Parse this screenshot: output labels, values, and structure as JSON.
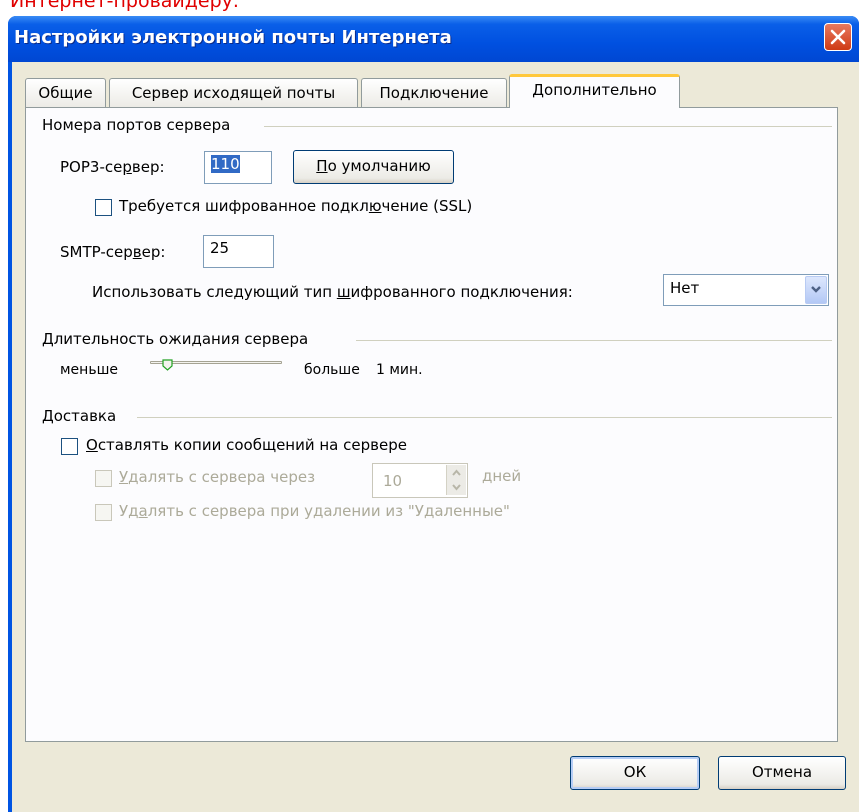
{
  "top_text": "Интернет-провайдеру.",
  "window": {
    "title": "Настройки электронной почты Интернета"
  },
  "tabs": [
    {
      "label": "Общие"
    },
    {
      "label": "Сервер исходящей почты"
    },
    {
      "label": "Подключение"
    },
    {
      "label": "Дополнительно"
    }
  ],
  "ports": {
    "group_label": "Номера портов сервера",
    "pop3_label_a": "POP3-се",
    "pop3_label_u": "р",
    "pop3_label_b": "вер:",
    "pop3_value": "110",
    "default_label": "По умолчанию",
    "default_u": "П",
    "ssl_label_a": "Требуется шифрованное подкл",
    "ssl_label_u": "ю",
    "ssl_label_b": "чение (SSL)",
    "smtp_label_a": "SMTP-сер",
    "smtp_label_u": "в",
    "smtp_label_b": "ер:",
    "smtp_value": "25",
    "encryption_label_a": "Использовать следующий тип ",
    "encryption_label_u": "ш",
    "encryption_label_b": "ифрованного подключения:",
    "encryption_value": "Нет"
  },
  "timeout": {
    "group_label_u": "Д",
    "group_label_b": "лительность ожидания сервера",
    "less_label": "меньше",
    "more_label": "больше",
    "value_label": "1 мин.",
    "level": 0.1
  },
  "delivery": {
    "group_label": "Доставка",
    "keep_copies_u": "О",
    "keep_copies_b": "ставлять копии сообщений на сервере",
    "remove_after_u": "У",
    "remove_after_b": "далять с сервера через",
    "days_value": "10",
    "days_label": "дней",
    "remove_deleted_a": "Уд",
    "remove_deleted_u": "а",
    "remove_deleted_b": "лять с сервера при удалении из \"Удаленные\""
  },
  "buttons": {
    "ok": "ОК",
    "cancel": "Отмена"
  }
}
